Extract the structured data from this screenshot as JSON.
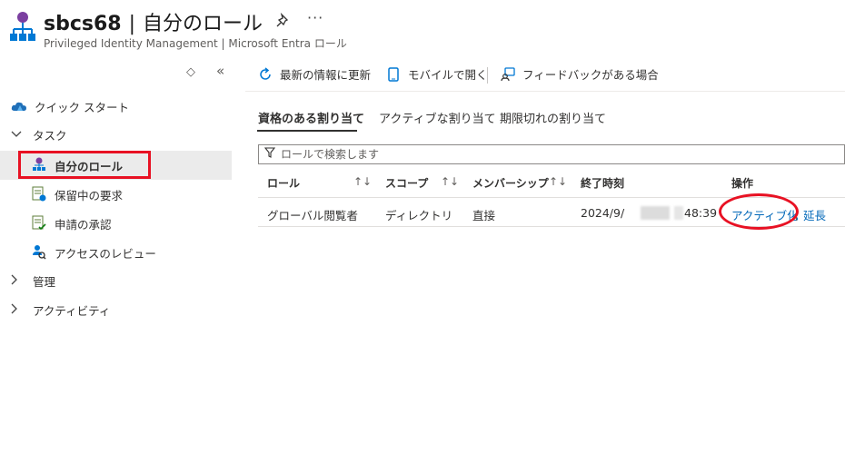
{
  "header": {
    "resource_name": "sbcs68",
    "separator": "|",
    "page_name": "自分のロール",
    "subtitle": "Privileged Identity Management | Microsoft Entra ロール",
    "more_label": "···",
    "icons": {
      "app": "org-structure-icon",
      "pin": "pin-icon",
      "more": "more-icon"
    }
  },
  "sidebar": {
    "collapse_up": "◇",
    "collapse_left": "«",
    "items": [
      {
        "label": "クイック スタート",
        "icon": "cloud-icon",
        "level": 0
      },
      {
        "label": "タスク",
        "icon": "chevron-down-icon",
        "level": 0,
        "expanded": true
      },
      {
        "label": "自分のロール",
        "icon": "user-roles-icon",
        "level": 1,
        "selected": true
      },
      {
        "label": "保留中の要求",
        "icon": "pending-request-icon",
        "level": 1
      },
      {
        "label": "申請の承認",
        "icon": "approve-request-icon",
        "level": 1
      },
      {
        "label": "アクセスのレビュー",
        "icon": "access-review-icon",
        "level": 1
      },
      {
        "label": "管理",
        "icon": "chevron-right-icon",
        "level": 0,
        "expanded": false
      },
      {
        "label": "アクティビティ",
        "icon": "chevron-right-icon",
        "level": 0,
        "expanded": false
      }
    ]
  },
  "toolbar": {
    "refresh_label": "最新の情報に更新",
    "mobile_label": "モバイルで開く",
    "feedback_label": "フィードバックがある場合"
  },
  "tabs": [
    {
      "label": "資格のある割り当て",
      "active": true
    },
    {
      "label": "アクティブな割り当て",
      "active": false
    },
    {
      "label": "期限切れの割り当て",
      "active": false
    }
  ],
  "search": {
    "placeholder": "ロールで検索します",
    "value": ""
  },
  "table": {
    "columns": [
      "ロール",
      "スコープ",
      "メンバーシップ",
      "終了時刻",
      "操作"
    ],
    "sort_glyph": "↑↓",
    "rows": [
      {
        "role": "グローバル閲覧者",
        "scope": "ディレクトリ",
        "membership": "直接",
        "end_time_prefix": "2024/9/",
        "end_time_suffix": "48:39",
        "action_activate": "アクティブ化",
        "action_extend": "延長"
      }
    ]
  },
  "colors": {
    "accent_link": "#0067b8",
    "highlight_red": "#e81123",
    "selected_bg": "#ebebeb"
  }
}
